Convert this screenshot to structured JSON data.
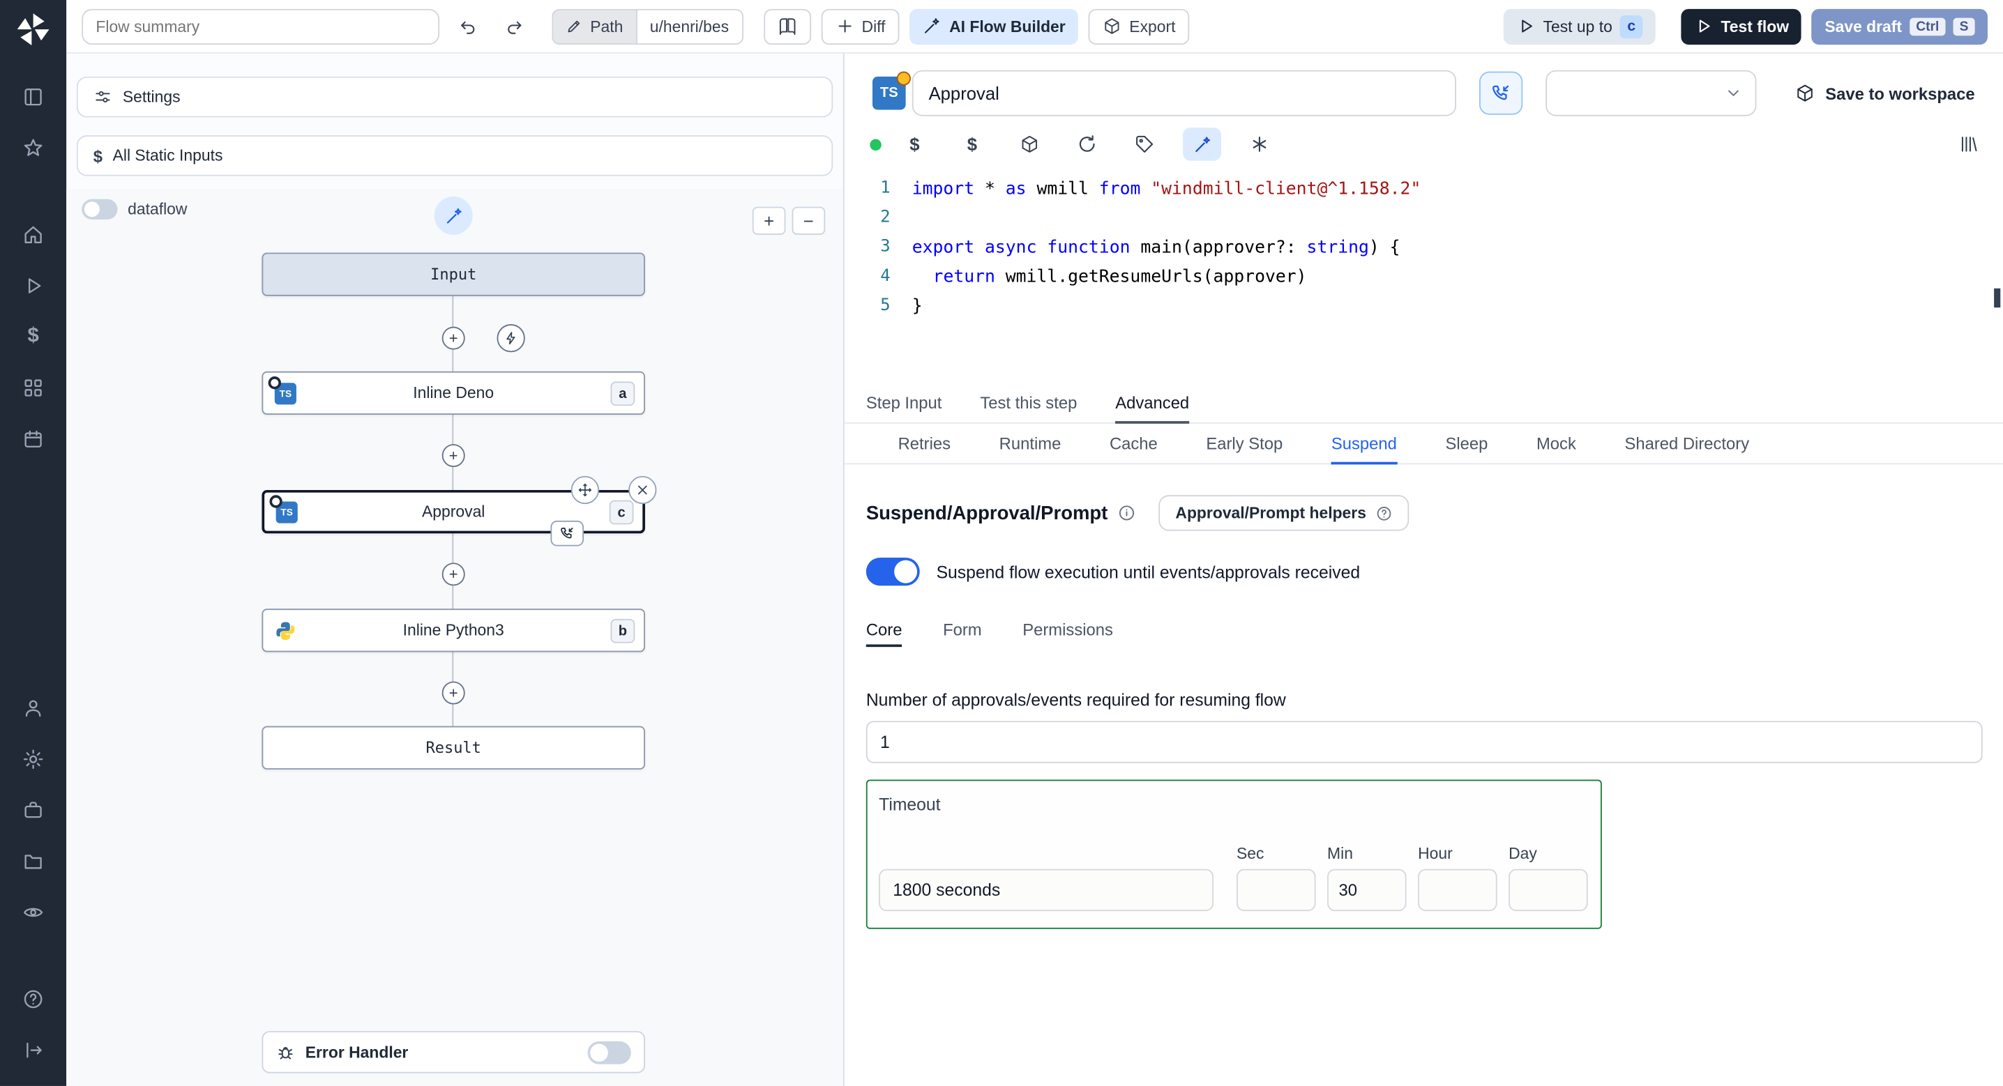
{
  "topbar": {
    "flow_summary_placeholder": "Flow summary",
    "path_label": "Path",
    "path_value": "u/henri/bes",
    "diff_label": "Diff",
    "ai_builder_label": "AI Flow Builder",
    "export_label": "Export",
    "test_up_to_label": "Test up to",
    "test_up_to_badge": "c",
    "test_flow_label": "Test flow",
    "save_draft_label": "Save draft",
    "save_draft_keys": [
      "Ctrl",
      "S"
    ]
  },
  "flow_panel": {
    "settings_label": "Settings",
    "static_inputs_label": "All Static Inputs",
    "dataflow_label": "dataflow",
    "input_node_label": "Input",
    "steps": [
      {
        "label": "Inline Deno",
        "badge": "a"
      },
      {
        "label": "Approval",
        "badge": "c"
      },
      {
        "label": "Inline Python3",
        "badge": "b"
      }
    ],
    "result_node_label": "Result",
    "error_handler_label": "Error Handler"
  },
  "editor": {
    "step_name": "Approval",
    "save_to_workspace_label": "Save to workspace",
    "code": {
      "lines": [
        {
          "n": "1",
          "tokens": [
            [
              "kw",
              "import"
            ],
            [
              "pl",
              " * "
            ],
            [
              "kw",
              "as"
            ],
            [
              "pl",
              " wmill "
            ],
            [
              "kw",
              "from"
            ],
            [
              "pl",
              " "
            ],
            [
              "str",
              "\"windmill-client@^1.158.2\""
            ]
          ]
        },
        {
          "n": "2",
          "tokens": []
        },
        {
          "n": "3",
          "tokens": [
            [
              "kw",
              "export"
            ],
            [
              "pl",
              " "
            ],
            [
              "kw",
              "async"
            ],
            [
              "pl",
              " "
            ],
            [
              "kw",
              "function"
            ],
            [
              "pl",
              " main(approver?: "
            ],
            [
              "kw",
              "string"
            ],
            [
              "pl",
              ") {"
            ]
          ]
        },
        {
          "n": "4",
          "tokens": [
            [
              "pl",
              "  "
            ],
            [
              "kw",
              "return"
            ],
            [
              "pl",
              " wmill.getResumeUrls(approver)"
            ]
          ]
        },
        {
          "n": "5",
          "tokens": [
            [
              "pl",
              "}"
            ]
          ]
        }
      ]
    }
  },
  "tabs": {
    "primary": [
      "Step Input",
      "Test this step",
      "Advanced"
    ],
    "primary_active": "Advanced",
    "advanced": [
      "Retries",
      "Runtime",
      "Cache",
      "Early Stop",
      "Suspend",
      "Sleep",
      "Mock",
      "Shared Directory"
    ],
    "advanced_active": "Suspend"
  },
  "suspend": {
    "title": "Suspend/Approval/Prompt",
    "helpers_button": "Approval/Prompt helpers",
    "toggle_label": "Suspend flow execution until events/approvals received",
    "subtabs": [
      "Core",
      "Form",
      "Permissions"
    ],
    "subtab_active": "Core",
    "approvals_label": "Number of approvals/events required for resuming flow",
    "approvals_value": "1",
    "timeout": {
      "label": "Timeout",
      "value": "1800 seconds",
      "units": [
        {
          "label": "Sec",
          "value": ""
        },
        {
          "label": "Min",
          "value": "30"
        },
        {
          "label": "Hour",
          "value": ""
        },
        {
          "label": "Day",
          "value": ""
        }
      ]
    }
  },
  "icons": {
    "sidebar": [
      "windmill-logo",
      "kanban-icon",
      "star-icon",
      "home-icon",
      "play-icon",
      "dollar-icon",
      "blocks-icon",
      "calendar-icon",
      "user-icon",
      "gear-icon",
      "toolbox-icon",
      "folder-icon",
      "eye-icon",
      "help-icon",
      "collapse-icon"
    ],
    "topbar": [
      "undo-icon",
      "redo-icon",
      "pencil-icon",
      "book-icon",
      "plus-icon",
      "wand-icon",
      "package-icon",
      "play-icon"
    ],
    "editor_toolbar": [
      "status-dot",
      "dollar-icon",
      "dollar-icon",
      "package-icon",
      "reload-icon",
      "tag-icon",
      "wand-icon",
      "asterisk-icon",
      "library-icon"
    ]
  },
  "colors": {
    "accent_blue": "#2563eb",
    "save_draft_bg": "#7e95c7",
    "dark_button_bg": "#18212f",
    "green_dot": "#22c55e",
    "timeout_border": "#15803d",
    "ts_icon_bg": "#3178c6",
    "sidebar_bg": "#212836"
  }
}
